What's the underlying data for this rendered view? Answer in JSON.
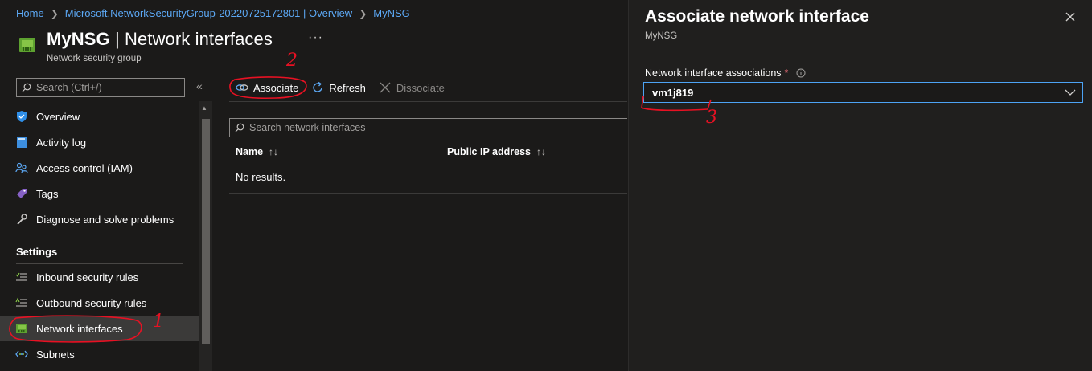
{
  "breadcrumb": {
    "items": [
      "Home",
      "Microsoft.NetworkSecurityGroup-20220725172801 | Overview",
      "MyNSG"
    ]
  },
  "header": {
    "title_strong": "MyNSG",
    "title_rest": " | Network interfaces",
    "more": "···",
    "subtitle": "Network security group"
  },
  "sidebar": {
    "search_placeholder": "Search (Ctrl+/)",
    "collapse": "«",
    "items": [
      {
        "label": "Overview",
        "icon": "shield-icon"
      },
      {
        "label": "Activity log",
        "icon": "activity-log-icon"
      },
      {
        "label": "Access control (IAM)",
        "icon": "people-icon"
      },
      {
        "label": "Tags",
        "icon": "tag-icon"
      },
      {
        "label": "Diagnose and solve problems",
        "icon": "wrench-icon"
      }
    ],
    "section_settings": "Settings",
    "settings_items": [
      {
        "label": "Inbound security rules",
        "icon": "inbound-rules-icon"
      },
      {
        "label": "Outbound security rules",
        "icon": "outbound-rules-icon"
      },
      {
        "label": "Network interfaces",
        "icon": "network-interface-icon",
        "selected": true
      },
      {
        "label": "Subnets",
        "icon": "subnet-icon"
      }
    ]
  },
  "toolbar": {
    "associate": "Associate",
    "refresh": "Refresh",
    "dissociate": "Dissociate"
  },
  "list": {
    "search_placeholder": "Search network interfaces",
    "columns": [
      "Name",
      "Public IP address"
    ],
    "sort_glyph": "↑↓",
    "empty": "No results."
  },
  "panel": {
    "title": "Associate network interface",
    "subtitle": "MyNSG",
    "field_label": "Network interface associations",
    "required_mark": "*",
    "selected_value": "vm1j819"
  },
  "annotations": {
    "one": "1",
    "two": "2",
    "three": "3"
  },
  "colors": {
    "link": "#5ca8f4",
    "annotation": "#e81123",
    "focus": "#4da3f4"
  }
}
